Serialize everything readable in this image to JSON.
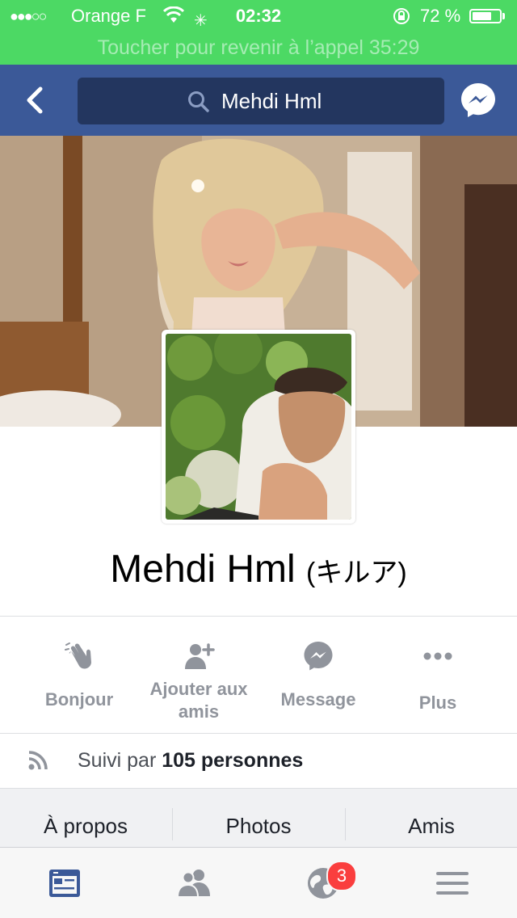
{
  "status_bar": {
    "signal": "●●●○○",
    "carrier": "Orange F",
    "time": "02:32",
    "battery_percent": "72 %",
    "battery_level": 0.72,
    "call_banner": "Toucher pour revenir à l’appel 35:29",
    "background": "#4cd964"
  },
  "nav": {
    "search_value": "Mehdi Hml",
    "background": "#3b5998"
  },
  "profile": {
    "name": "Mehdi Hml",
    "alt_name": "(キルア)"
  },
  "actions": [
    {
      "label": "Bonjour",
      "icon": "wave-hand-icon"
    },
    {
      "label": "Ajouter aux amis",
      "icon": "add-friend-icon"
    },
    {
      "label": "Message",
      "icon": "messenger-icon"
    },
    {
      "label": "Plus",
      "icon": "more-dots-icon"
    }
  ],
  "followers": {
    "prefix": "Suivi par ",
    "count_text": "105 personnes"
  },
  "tabs": [
    "À propos",
    "Photos",
    "Amis"
  ],
  "tab_bar": {
    "items": [
      "news-feed-icon",
      "friends-icon",
      "notifications-globe-icon",
      "menu-icon"
    ],
    "notifications_badge": "3",
    "active_color": "#3b5998"
  }
}
